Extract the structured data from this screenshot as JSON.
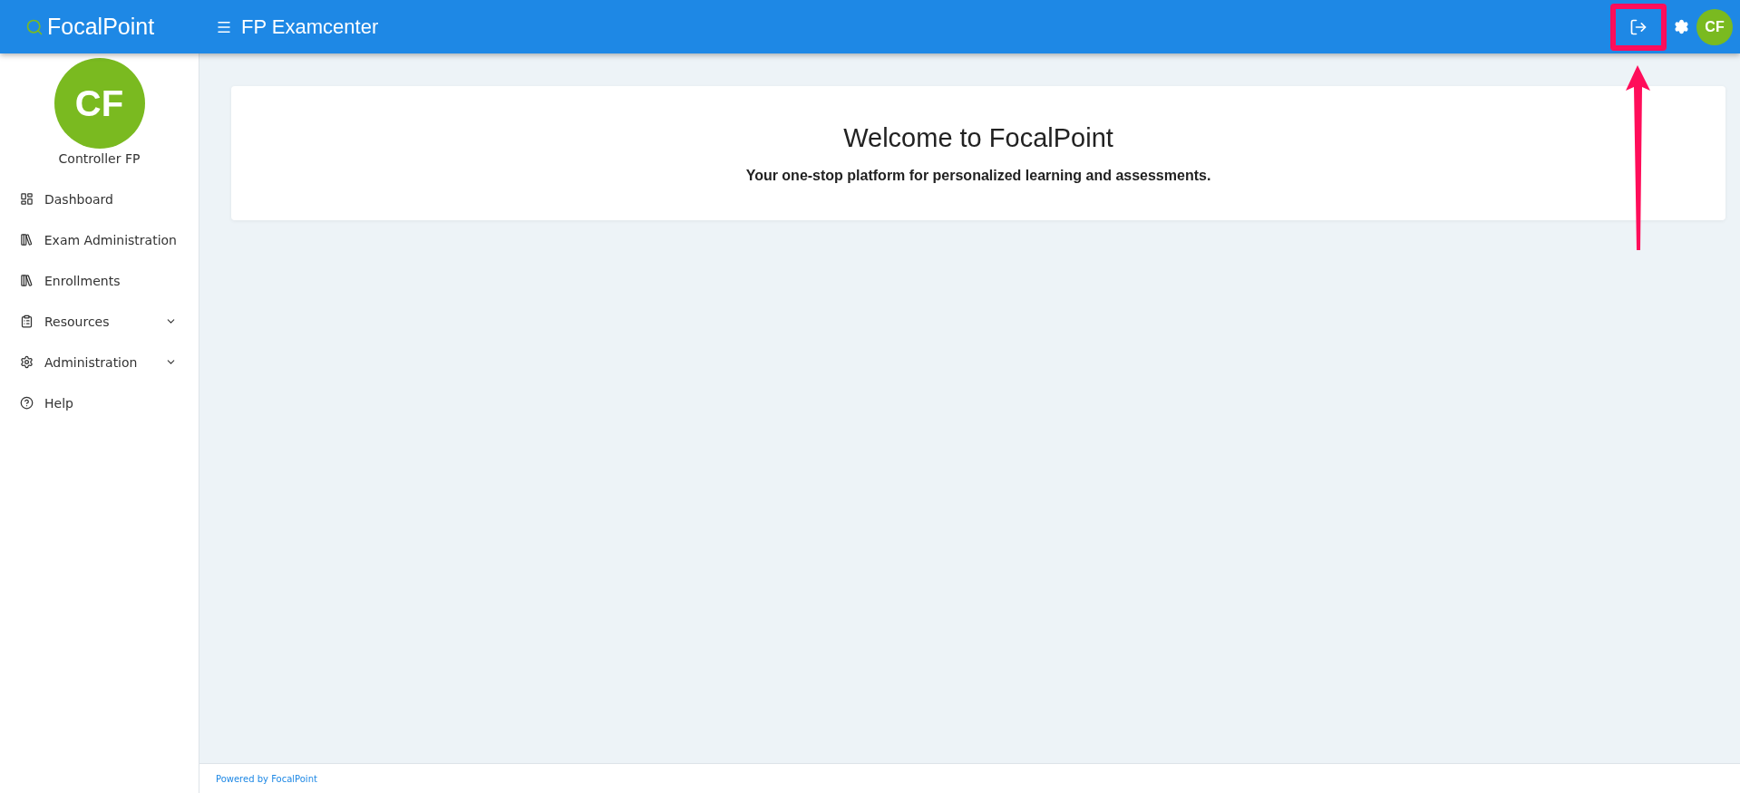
{
  "header": {
    "logo": "FocalPoint",
    "title": "FP Examcenter",
    "actions": [
      {
        "kind": "logout",
        "highlighted": true
      },
      {
        "kind": "settings",
        "highlighted": false
      },
      {
        "kind": "avatar",
        "initials": "CF",
        "highlighted": false
      }
    ]
  },
  "sidebar": {
    "user": {
      "initials": "CF",
      "name": "Controller FP"
    },
    "items": [
      {
        "kind": "dashboard",
        "label": "Dashboard",
        "expandable": false
      },
      {
        "kind": "library",
        "label": "Exam Administration",
        "expandable": false
      },
      {
        "kind": "library",
        "label": "Enrollments",
        "expandable": false
      },
      {
        "kind": "clipboard",
        "label": "Resources",
        "expandable": true
      },
      {
        "kind": "gear",
        "label": "Administration",
        "expandable": true
      },
      {
        "kind": "help",
        "label": "Help",
        "expandable": false
      }
    ]
  },
  "welcome": {
    "title": "Welcome to FocalPoint",
    "subtitle": "Your one-stop platform for personalized learning and assessments."
  },
  "footer": {
    "text": "Powered by FocalPoint"
  }
}
